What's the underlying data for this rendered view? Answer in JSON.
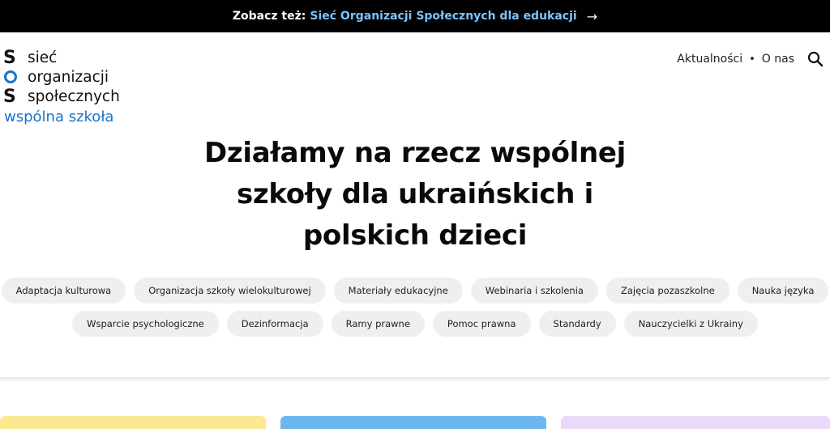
{
  "topbar": {
    "prefix": "Zobacz też:",
    "link": "Sieć Organizacji Społecznych dla edukacji",
    "arrow": "→"
  },
  "logo": {
    "letters": [
      "S",
      "S"
    ],
    "words": [
      "sieć",
      "organizacji",
      "społecznych"
    ],
    "subtitle": "wspólna szkoła"
  },
  "nav": {
    "items": [
      "Aktualności",
      "O nas"
    ],
    "separator": "•",
    "search_icon": "search-icon"
  },
  "hero": {
    "lines": [
      "Działamy na rzecz wspólnej",
      "szkoły dla ukraińskich i",
      "polskich dzieci"
    ]
  },
  "tags": {
    "row1": [
      "Adaptacja kulturowa",
      "Organizacja szkoły wielokulturowej",
      "Materiały edukacyjne",
      "Webinaria i szkolenia",
      "Zajęcia pozaszkolne",
      "Nauka języka"
    ],
    "row2": [
      "Wsparcie psychologiczne",
      "Dezinformacja",
      "Ramy prawne",
      "Pomoc prawna",
      "Standardy",
      "Nauczycielki z Ukrainy"
    ]
  },
  "colors": {
    "topbar_bg": "#000000",
    "topbar_link": "#7cc4ff",
    "logo_blue": "#1a73c8",
    "tag_bg": "#efefef",
    "card_yellow": "#fbe991",
    "card_blue": "#6db7f0",
    "card_lilac": "#ead9f7"
  }
}
